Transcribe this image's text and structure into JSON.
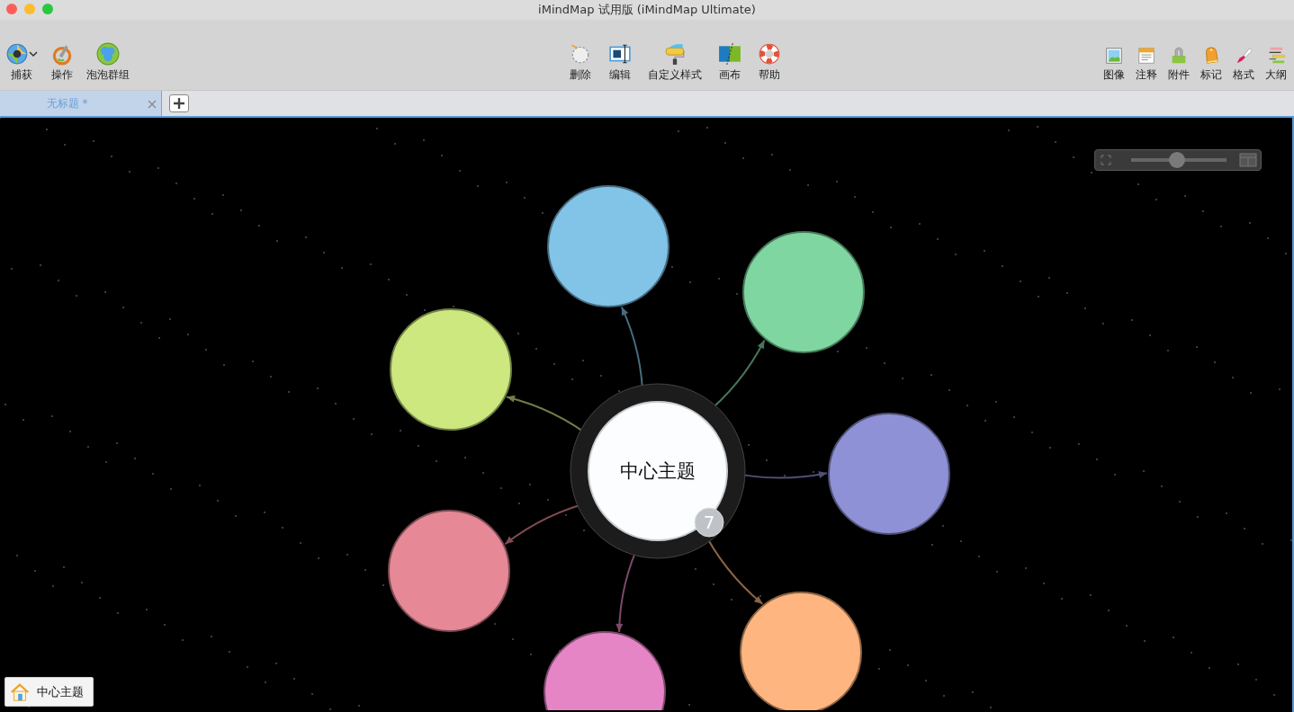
{
  "window": {
    "title": "iMindMap 试用版 (iMindMap Ultimate)"
  },
  "toolbar": {
    "left": [
      {
        "label": "捕获",
        "has_menu": true
      },
      {
        "label": "操作",
        "has_menu": false
      },
      {
        "label": "泡泡群组",
        "has_menu": false
      }
    ],
    "center": [
      {
        "label": "删除"
      },
      {
        "label": "编辑"
      },
      {
        "label": "自定义样式"
      },
      {
        "label": "画布"
      },
      {
        "label": "帮助"
      }
    ],
    "right": [
      {
        "label": "图像"
      },
      {
        "label": "注释"
      },
      {
        "label": "附件"
      },
      {
        "label": "标记"
      },
      {
        "label": "格式"
      },
      {
        "label": "大纲"
      }
    ]
  },
  "tabs": [
    {
      "label": "无标题 *",
      "selected": true
    }
  ],
  "canvas": {
    "zoom": {
      "level": 0.48
    },
    "central_topic": {
      "text": "中心主题",
      "badge": "7"
    },
    "branches": [
      {
        "color": "#82c4e8"
      },
      {
        "color": "#7fd6a0"
      },
      {
        "color": "#8f91d6"
      },
      {
        "color": "#ffb57f"
      },
      {
        "color": "#e585c6"
      },
      {
        "color": "#e68896"
      },
      {
        "color": "#cce87e"
      }
    ],
    "breadcrumb": {
      "label": "中心主题"
    }
  }
}
